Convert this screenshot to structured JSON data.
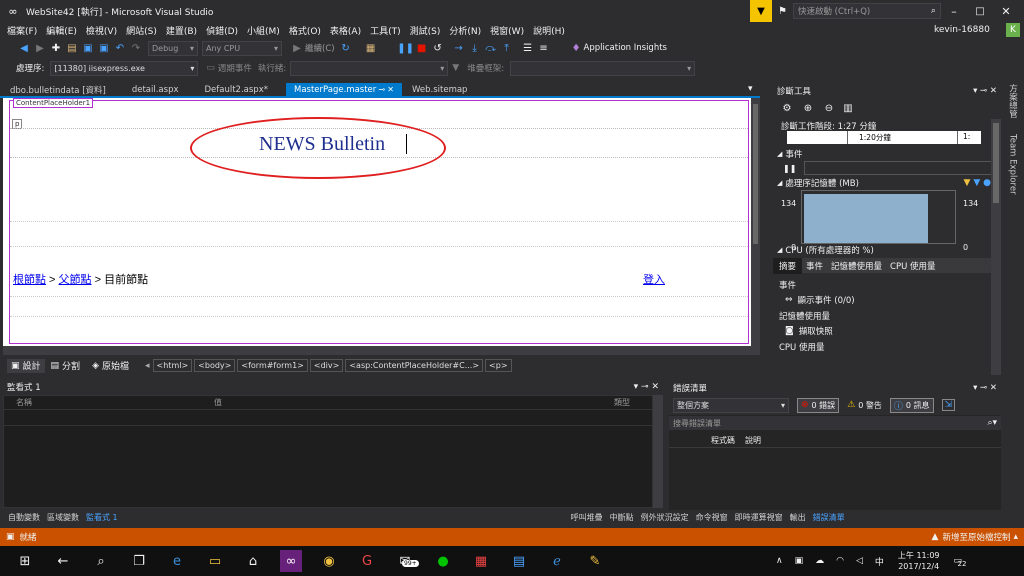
{
  "window": {
    "title": "WebSite42 [執行] - Microsoft Visual Studio",
    "quick_launch": "快速啟動 (Ctrl+Q)",
    "user": "kevin-16880",
    "user_initial": "K"
  },
  "menu": [
    "檔案(F)",
    "編輯(E)",
    "檢視(V)",
    "網站(S)",
    "建置(B)",
    "偵錯(D)",
    "小組(M)",
    "格式(O)",
    "表格(A)",
    "工具(T)",
    "測試(S)",
    "分析(N)",
    "視窗(W)",
    "說明(H)"
  ],
  "toolbar": {
    "config": "Debug",
    "platform": "Any CPU",
    "continue": "繼續(C)",
    "app_insights": "Application Insights"
  },
  "procbar": {
    "label": "處理序:",
    "process": "[11380] iisexpress.exe",
    "lifecycle": "週期事件",
    "thread": "執行緒:",
    "stackframe": "堆疊框架:"
  },
  "tabs": [
    {
      "label": "dbo.bulletindata [資料]"
    },
    {
      "label": "detail.aspx"
    },
    {
      "label": "Default2.aspx*"
    },
    {
      "label": "MasterPage.master",
      "active": true
    },
    {
      "label": "Web.sitemap"
    }
  ],
  "editor": {
    "placeholder_label": "ContentPlaceHolder1",
    "p_tag": "p",
    "heading": "NEWS Bulletin",
    "breadcrumb": {
      "root": "根節點",
      "sep1": " > ",
      "parent": "父節點",
      "sep2": " > ",
      "current": "目前節點"
    },
    "login": "登入"
  },
  "design_bar": {
    "design": "設計",
    "split": "分割",
    "source": "原始檔",
    "crumbs": [
      "<html>",
      "<body>",
      "<form#form1>",
      "<div>",
      "<asp:ContentPlaceHolder#C...>",
      "<p>"
    ]
  },
  "diagnostics": {
    "title": "診斷工具",
    "session": "診斷工作階段: 1:27 分鐘",
    "timeline_label": "1:20分鐘",
    "timeline_label2": "1:",
    "events": "事件",
    "memory": "處理序記憶體 (MB)",
    "mem_max": "134",
    "mem_min": "0",
    "mem_level": 0.95,
    "cpu": "CPU (所有處理器的 %)",
    "subtabs": [
      "摘要",
      "事件",
      "記憶體使用量",
      "CPU 使用量"
    ],
    "events_header": "事件",
    "show_events": "顯示事件 (0/0)",
    "mem_usage": "記憶體使用量",
    "snapshot": "擷取快照",
    "cpu_usage": "CPU 使用量"
  },
  "watch": {
    "title": "監看式 1",
    "col_name": "名稱",
    "col_value": "值",
    "col_type": "類型"
  },
  "errors": {
    "title": "錯誤清單",
    "scope": "整個方案",
    "errors": "0 錯誤",
    "warnings": "0 警告",
    "messages": "0 訊息",
    "search": "搜尋錯誤清單",
    "col_code": "程式碼",
    "col_desc": "說明"
  },
  "bottom_left_tabs": [
    "自動變數",
    "區域變數",
    "監看式 1"
  ],
  "bottom_right_tabs": [
    "呼叫堆疊",
    "中斷點",
    "例外狀況設定",
    "命令視窗",
    "即時運算視窗",
    "輸出",
    "錯誤清單"
  ],
  "status": {
    "left": "就緒",
    "right": "新增至原始檔控制"
  },
  "sidebar": {
    "item1": "方案總管",
    "item2": "Team Explorer"
  },
  "taskbar": {
    "time": "上午 11:09",
    "date": "2017/12/4",
    "ime": "中",
    "notif": "22",
    "badge": "99+"
  },
  "colors": {
    "accent": "#007acc",
    "status": "#ca5100",
    "link": "#0000ee",
    "oval": "#e02020"
  }
}
